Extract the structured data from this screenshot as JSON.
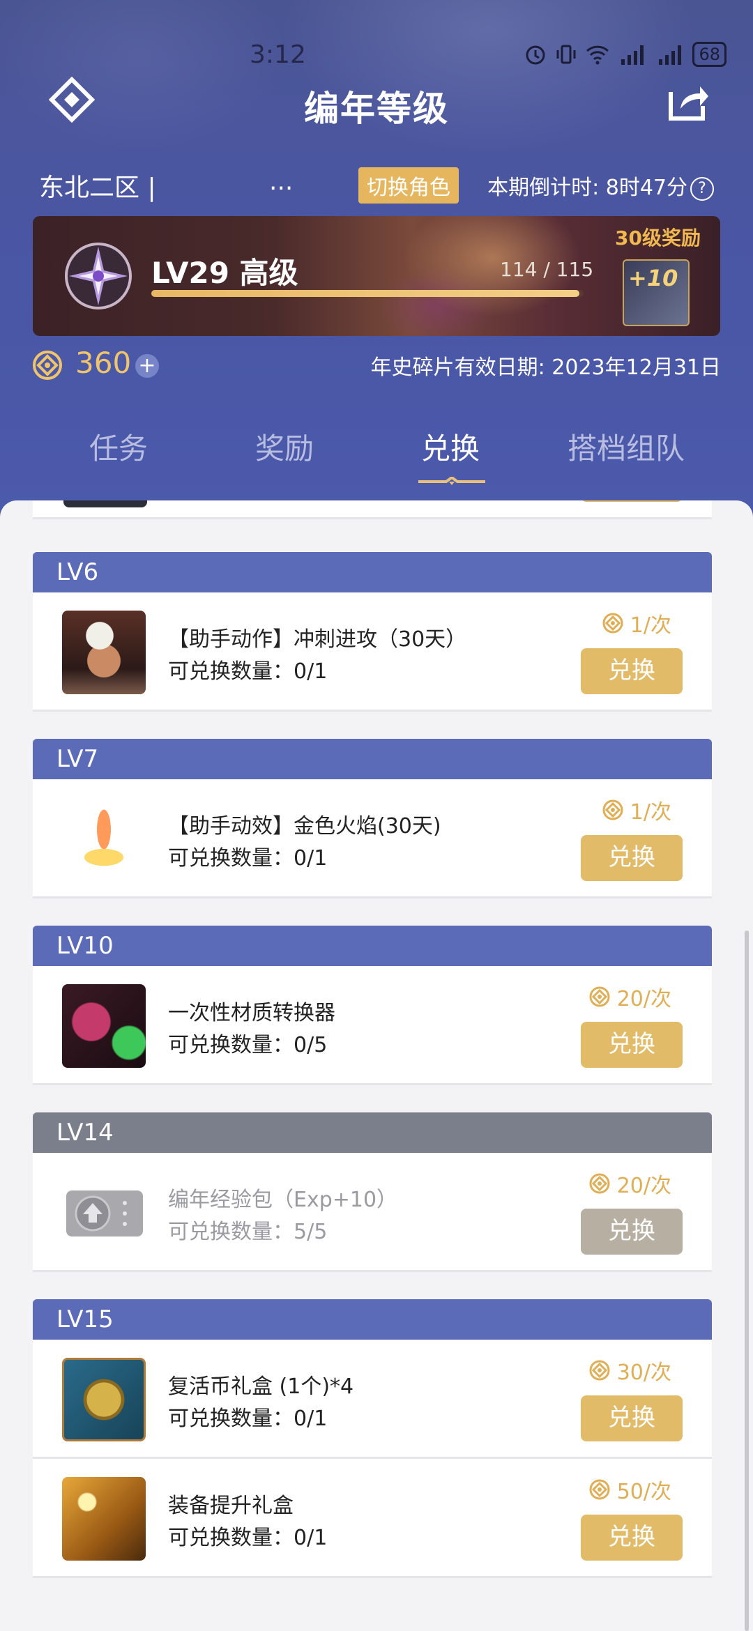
{
  "status_bar": {
    "time": "3:12",
    "network": "5G 4G",
    "battery": "68"
  },
  "header": {
    "title": "编年等级",
    "server": "东北二区 |",
    "server_ellipsis": "...",
    "switch_role": "切换角色",
    "countdown": "本期倒计时: 8时47分",
    "help": "?"
  },
  "level": {
    "label": "LV29 高级",
    "exp_current": "114",
    "exp_total": "115",
    "exp_fraction": 0.99,
    "reward_label": "30级奖励",
    "reward_badge": "+10"
  },
  "currency": {
    "amount": "360",
    "plus": "+",
    "expiry": "年史碎片有效日期: 2023年12月31日"
  },
  "tabs": [
    {
      "label": "任务"
    },
    {
      "label": "奖励"
    },
    {
      "label": "兑换",
      "active": true
    },
    {
      "label": "搭档组队"
    }
  ],
  "colors": {
    "accent": "#e2bb69",
    "section_header": "#5b6bb8",
    "locked_header": "#7b7f8c",
    "coin": "#e0ae54"
  },
  "sections": [
    {
      "level": "LV6",
      "items": [
        {
          "name": "【助手动作】冲刺进攻（30天）",
          "qty": "可兑换数量：0/1",
          "cost": "1/次",
          "button": "兑换",
          "icon": "warrior-portrait-icon"
        }
      ]
    },
    {
      "level": "LV7",
      "items": [
        {
          "name": "【助手动效】金色火焰(30天)",
          "qty": "可兑换数量：0/1",
          "cost": "1/次",
          "button": "兑换",
          "icon": "golden-flame-icon"
        }
      ]
    },
    {
      "level": "LV10",
      "items": [
        {
          "name": "一次性材质转换器",
          "qty": "可兑换数量：0/5",
          "cost": "20/次",
          "button": "兑换",
          "icon": "material-converter-icon"
        }
      ]
    },
    {
      "level": "LV14",
      "locked": true,
      "items": [
        {
          "name": "编年经验包（Exp+10）",
          "qty": "可兑换数量：5/5",
          "cost": "20/次",
          "button": "兑换",
          "icon": "exp-ticket-icon"
        }
      ]
    },
    {
      "level": "LV15",
      "items": [
        {
          "name": "复活币礼盒 (1个)*4",
          "qty": "可兑换数量：0/1",
          "cost": "30/次",
          "button": "兑换",
          "icon": "revive-coin-box-icon"
        },
        {
          "name": "装备提升礼盒",
          "qty": "可兑换数量：0/1",
          "cost": "50/次",
          "button": "兑换",
          "icon": "equipment-chest-icon"
        }
      ]
    }
  ]
}
